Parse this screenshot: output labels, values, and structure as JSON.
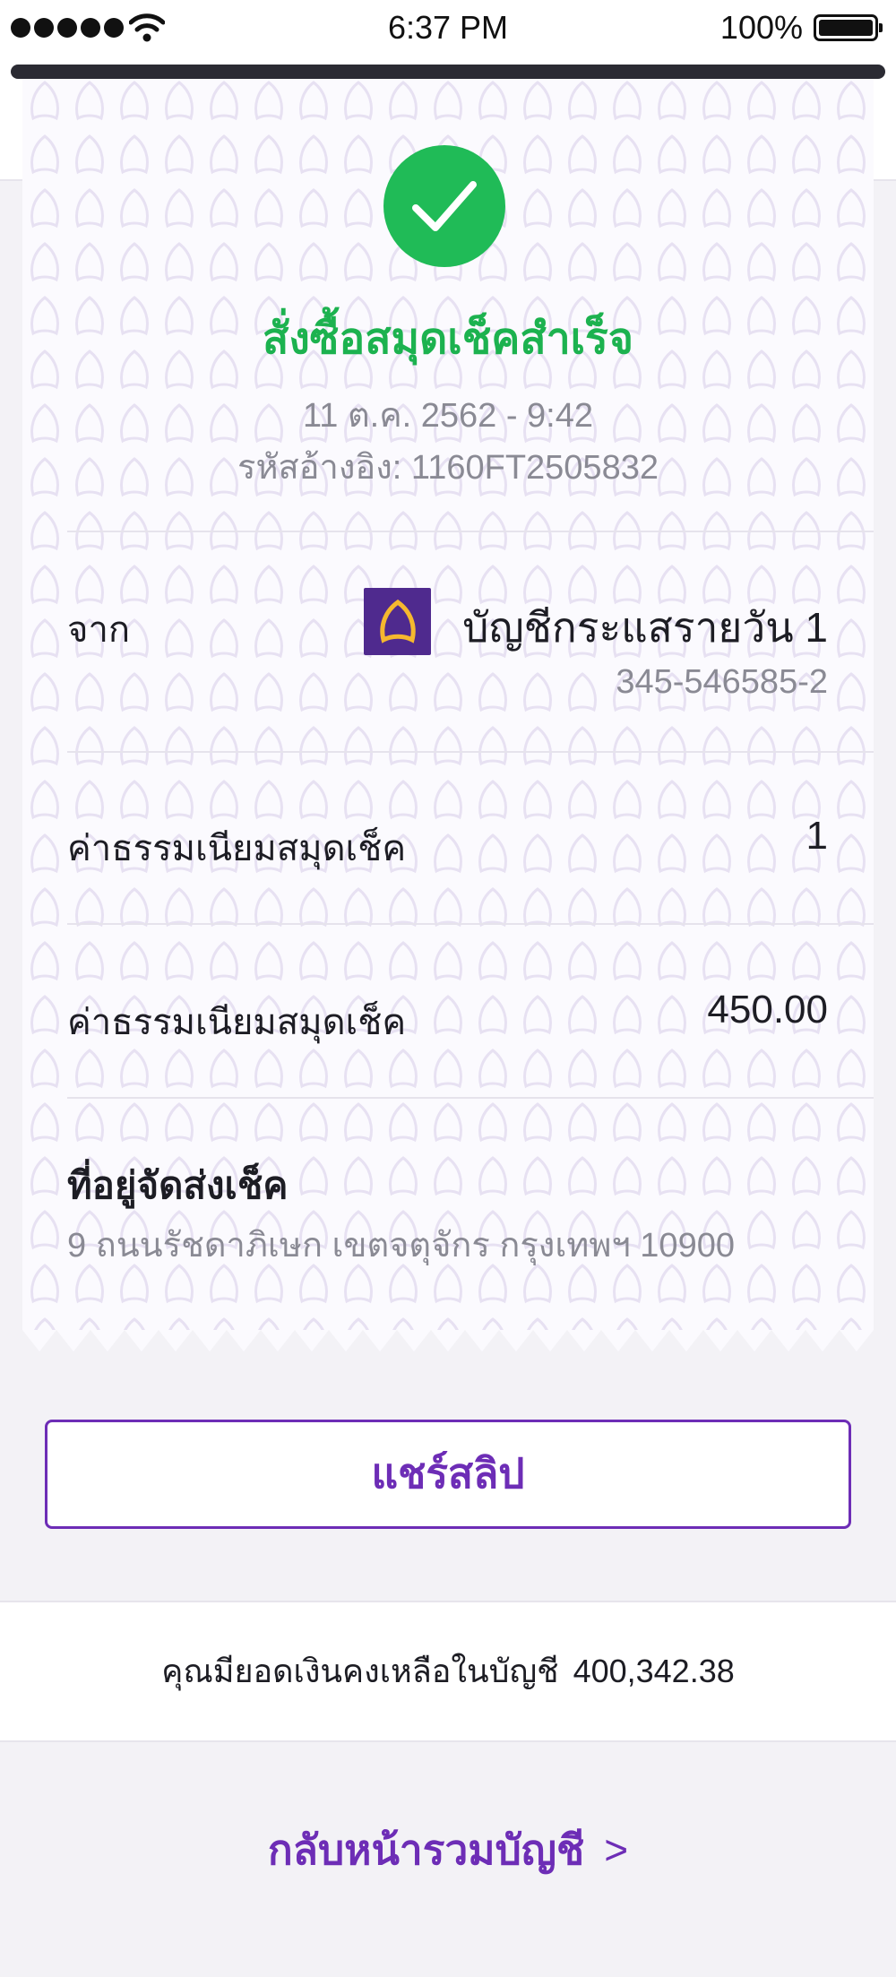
{
  "status_bar": {
    "time": "6:37 PM",
    "battery": "100%"
  },
  "receipt": {
    "title": "สั่งซื้อสมุดเช็คสำเร็จ",
    "datetime": "11 ต.ค. 2562 - 9:42",
    "reference": "รหัสอ้างอิง: 1160FT2505832",
    "from": {
      "label": "จาก",
      "account_name": "บัญชีกระแสรายวัน 1",
      "account_number": "345-546585-2"
    },
    "rows": [
      {
        "label": "ค่าธรรมเนียมสมุดเช็ค",
        "value": "1"
      },
      {
        "label": "ค่าธรรมเนียมสมุดเช็ค",
        "value": "450.00"
      }
    ],
    "address": {
      "label": "ที่อยู่จัดส่งเช็ค",
      "value": "9 ถนนรัชดาภิเษก เขตจตุจักร กรุงเทพฯ 10900"
    }
  },
  "share_button": {
    "label": "แชร์สลิป"
  },
  "balance": {
    "label": "คุณมียอดเงินคงเหลือในบัญชี",
    "amount": "400,342.38"
  },
  "back_link": {
    "label": "กลับหน้ารวมบัญชี",
    "chevron": ">"
  },
  "colors": {
    "accent": "#6d2db6",
    "success": "#1cb24f",
    "bank_brand": "#4f2a8e"
  },
  "icons": [
    "signal-icon",
    "wifi-icon",
    "battery-icon",
    "check-icon",
    "bank-logo-icon"
  ]
}
